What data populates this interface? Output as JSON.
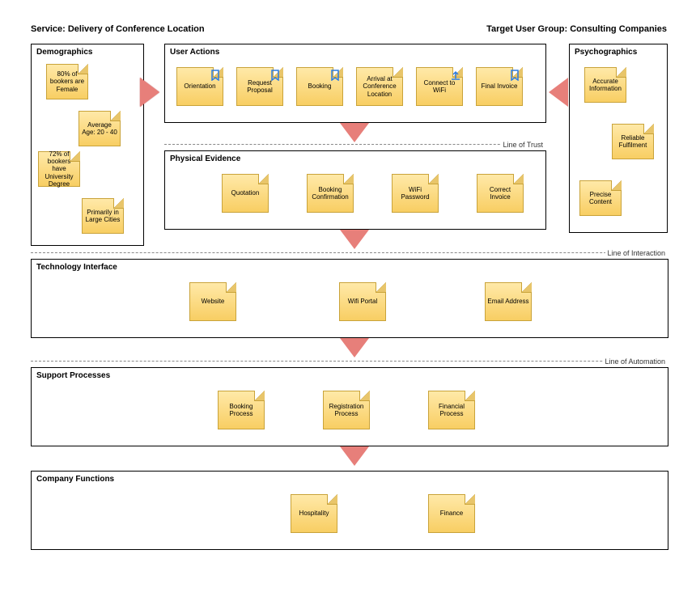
{
  "header": {
    "left": "Service: Delivery of Conference Location",
    "right": "Target User Group: Consulting Companies"
  },
  "lines": {
    "trust": "Line of Trust",
    "interaction": "Line of Interaction",
    "automation": "Line of Automation"
  },
  "sections": {
    "demographics": {
      "title": "Demographics",
      "notes": [
        "80% of bookers are Female",
        "Average Age: 20 - 40",
        "72% of bookers have University Degree",
        "Primarily in Large Cities"
      ]
    },
    "psychographics": {
      "title": "Psychographics",
      "notes": [
        "Accurate Information",
        "Reliable Fulfilment",
        "Precise Content"
      ]
    },
    "userActions": {
      "title": "User Actions",
      "notes": [
        "Orientation",
        "Request Proposal",
        "Booking",
        "Arrival at Conference Location",
        "Connect to WiFi",
        "Final Invoice"
      ]
    },
    "physicalEvidence": {
      "title": "Physical Evidence",
      "notes": [
        "Quotation",
        "Booking Confirmation",
        "WiFi Password",
        "Correct Invoice"
      ]
    },
    "technologyInterface": {
      "title": "Technology Interface",
      "notes": [
        "Website",
        "Wifi Portal",
        "Email Address"
      ]
    },
    "supportProcesses": {
      "title": "Support Processes",
      "notes": [
        "Booking Process",
        "Registration Process",
        "Financial Process"
      ]
    },
    "companyFunctions": {
      "title": "Company Functions",
      "notes": [
        "Hospitality",
        "Finance"
      ]
    }
  }
}
